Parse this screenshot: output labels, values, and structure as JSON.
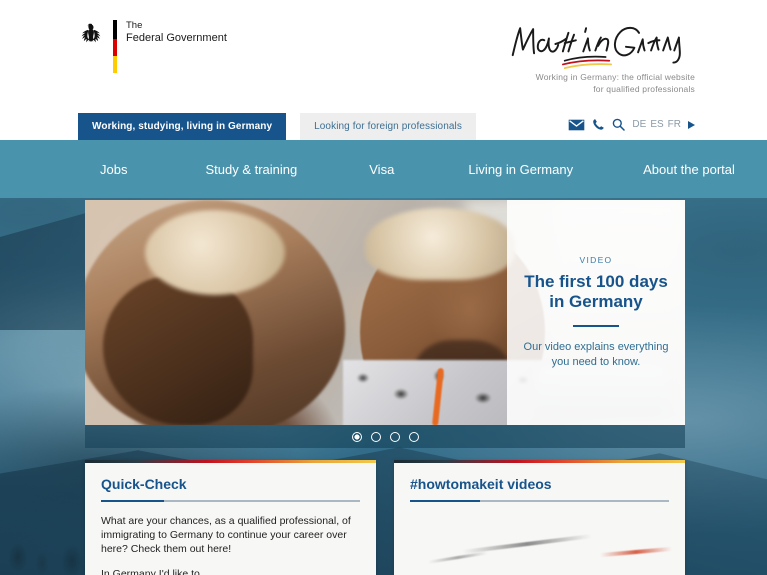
{
  "header": {
    "federal": {
      "line1": "The",
      "line2": "Federal Government",
      "eagle_icon": "federal-eagle-icon"
    },
    "brand": {
      "signature": "Make it in Germany",
      "tagline_line1": "Working in Germany: the official website",
      "tagline_line2": "for qualified professionals"
    },
    "tabs": [
      {
        "label": "Working, studying, living in Germany",
        "active": true
      },
      {
        "label": "Looking for foreign professionals",
        "active": false
      }
    ],
    "utilities": {
      "mail_icon": "mail-icon",
      "phone_icon": "phone-icon",
      "search_icon": "search-icon",
      "languages": [
        "DE",
        "ES",
        "FR"
      ],
      "more_icon": "triangle-right-icon"
    }
  },
  "nav": {
    "items": [
      {
        "label": "Jobs"
      },
      {
        "label": "Study & training"
      },
      {
        "label": "Visa"
      },
      {
        "label": "Living in Germany"
      },
      {
        "label": "About the portal"
      }
    ]
  },
  "hero": {
    "eyebrow": "VIDEO",
    "title_line1": "The first 100 days",
    "title_line2": "in Germany",
    "description": "Our video explains everything you need to know.",
    "carousel": {
      "total": 4,
      "active_index": 0
    }
  },
  "cards": [
    {
      "title": "Quick-Check",
      "paragraph1": "What are your chances, as a qualified professional, of immigrating to Germany to continue your career over here? Check them out here!",
      "paragraph2": "In Germany I'd like to..."
    },
    {
      "title": "#howtomakeit videos"
    }
  ],
  "colors": {
    "brand_blue": "#17548c",
    "nav_teal": "#4a93ac",
    "flag_black": "#000000",
    "flag_red": "#dd0000",
    "flag_gold": "#ffcc00",
    "tab_inactive_bg": "#eeeeee",
    "card_bg": "#f7f7f6"
  }
}
